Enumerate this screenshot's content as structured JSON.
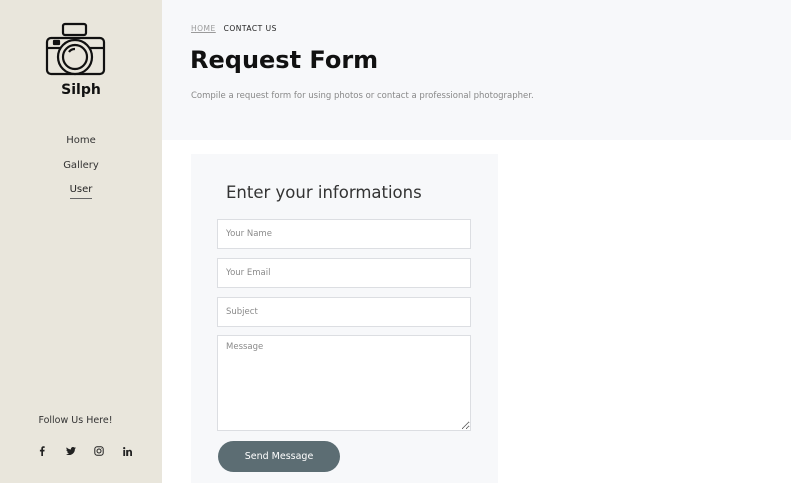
{
  "brand": {
    "name": "Silph",
    "logo_icon": "camera-icon"
  },
  "nav": {
    "items": [
      {
        "label": "Home",
        "active": false
      },
      {
        "label": "Gallery",
        "active": false
      },
      {
        "label": "User",
        "active": true
      }
    ]
  },
  "social": {
    "heading": "Follow Us Here!",
    "icons": [
      "facebook-icon",
      "twitter-icon",
      "instagram-icon",
      "linkedin-icon"
    ]
  },
  "breadcrumb": {
    "home": "HOME",
    "current": "CONTACT US"
  },
  "header": {
    "title": "Request Form",
    "description": "Compile a request form for using photos or contact a professional photographer."
  },
  "form": {
    "title": "Enter your informations",
    "name_placeholder": "Your Name",
    "email_placeholder": "Your Email",
    "subject_placeholder": "Subject",
    "message_placeholder": "Message",
    "submit_label": "Send Message"
  },
  "colors": {
    "sidebar_bg": "#e9e6dc",
    "hero_bg": "#f7f8fa",
    "button_bg": "#5c6d73"
  }
}
